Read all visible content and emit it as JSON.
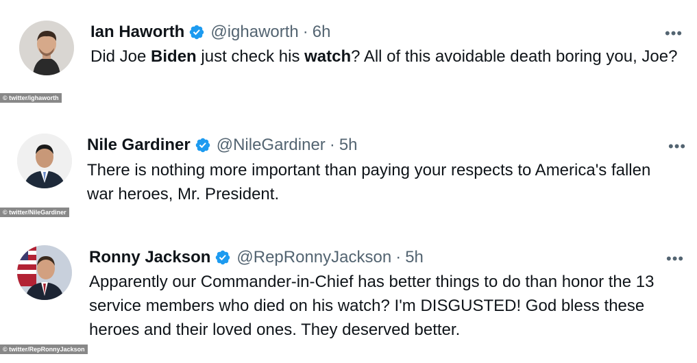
{
  "tweets": [
    {
      "name": "Ian Haworth",
      "handle": "@ighaworth",
      "separator": "·",
      "time": "6h",
      "text_parts": [
        "Did Joe ",
        "Biden",
        " just check his ",
        "watch",
        "? All of this avoidable death boring you, Joe?"
      ],
      "credit": "© twitter/ighaworth",
      "more": "•••"
    },
    {
      "name": "Nile Gardiner",
      "handle": "@NileGardiner",
      "separator": "·",
      "time": "5h",
      "text": "There is nothing more important than paying your respects to America's fallen war heroes, Mr. President.",
      "credit": "© twitter/NileGardiner",
      "more": "•••"
    },
    {
      "name": "Ronny Jackson",
      "handle": "@RepRonnyJackson",
      "separator": "·",
      "time": "5h",
      "text": "Apparently our Commander-in-Chief has better things to do than honor the 13 service members who died on his watch? I'm DISGUSTED! God bless these heroes and their loved ones. They deserved better.",
      "credit": "© twitter/RepRonnyJackson",
      "more": "•••"
    }
  ],
  "colors": {
    "verified": "#1d9bf0",
    "secondary_text": "#536471",
    "primary_text": "#0f1419",
    "credit_bg": "#888888"
  },
  "icons": {
    "verified": "verified-badge-icon",
    "more": "more-options-icon"
  }
}
